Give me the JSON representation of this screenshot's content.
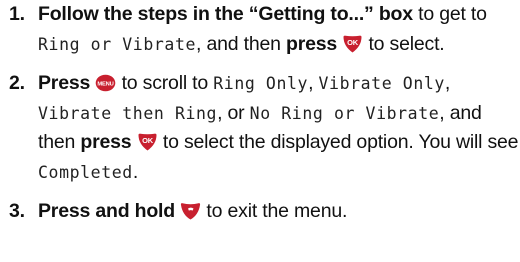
{
  "steps": [
    {
      "number": "1.",
      "b1": "Follow the steps in the “Getting to...” box",
      "t1": " to get to ",
      "lcd1": "Ring or Vibrate",
      "t2": ", and then ",
      "b2": "press",
      "button": "OK",
      "t3": " to select."
    },
    {
      "number": "2.",
      "b1": "Press",
      "button1": "MENU",
      "t1": " to scroll to ",
      "lcd1": "Ring Only",
      "t2": ", ",
      "lcd2": "Vibrate Only",
      "t3": ", ",
      "lcd3": "Vibrate then Ring",
      "t4": ", or ",
      "lcd4": "No Ring or Vibrate",
      "t5": ", and then ",
      "b2": "press",
      "button2": "OK",
      "t6": " to select the displayed option. You will see ",
      "lcd5": "Completed",
      "t7": "."
    },
    {
      "number": "3.",
      "b1": "Press and hold",
      "t1": " to exit the menu."
    }
  ],
  "colors": {
    "button_fill": "#c8202f",
    "button_text": "#ffffff"
  },
  "icons": [
    "ok-button-icon",
    "menu-button-icon",
    "end-button-icon"
  ]
}
